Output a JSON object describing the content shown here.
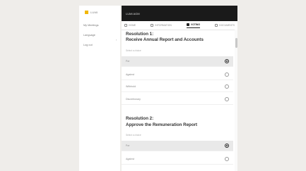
{
  "sidebar": {
    "logo_text": "LUMI",
    "items": [
      {
        "label": "My Meetings"
      },
      {
        "label": "Language"
      },
      {
        "label": "Log out"
      }
    ]
  },
  "topbar": {
    "title": "LUMI AGM"
  },
  "tabs": [
    {
      "label": "HOME",
      "icon": "home-icon"
    },
    {
      "label": "INFORMATION",
      "icon": "info-icon"
    },
    {
      "label": "VOTING",
      "icon": "vote-icon",
      "active": true
    },
    {
      "label": "DOCUMENTS",
      "icon": "document-icon"
    }
  ],
  "resolutions": [
    {
      "number": "Resolution 1:",
      "title": "Receive Annual Report and Accounts",
      "subtitle": "Select a choice",
      "options": [
        {
          "label": "For",
          "selected": true
        },
        {
          "label": "Against",
          "selected": false
        },
        {
          "label": "Withhold",
          "selected": false
        },
        {
          "label": "Discretionary",
          "selected": false
        }
      ]
    },
    {
      "number": "Resolution 2:",
      "title": "Approve the Remuneration Report",
      "subtitle": "Select a choice",
      "options": [
        {
          "label": "For",
          "selected": true
        },
        {
          "label": "Against",
          "selected": false
        }
      ]
    }
  ],
  "colors": {
    "accent": "#f2b705",
    "topbar": "#1a1a1a",
    "selected_row": "#e9e9e9"
  }
}
